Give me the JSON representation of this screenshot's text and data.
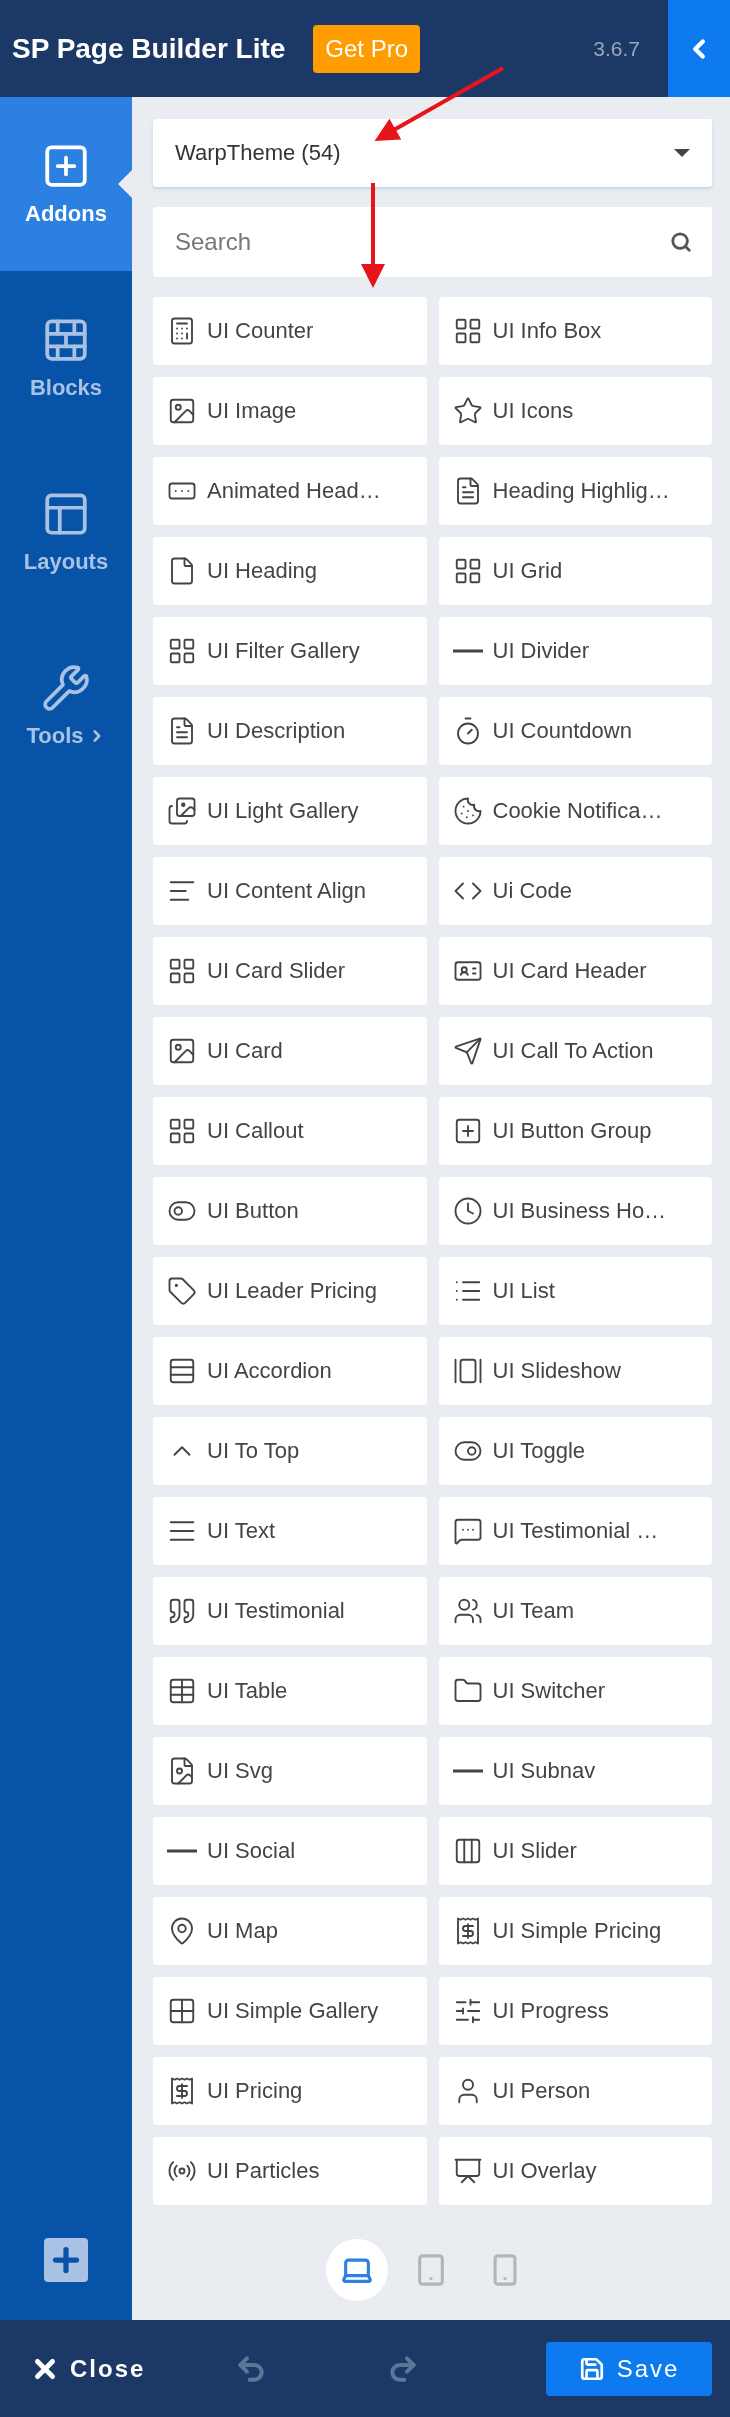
{
  "header": {
    "title": "SP Page Builder Lite",
    "badge": "Get Pro",
    "version": "3.6.7"
  },
  "sidebar": {
    "items": [
      {
        "label": "Addons",
        "selected": true,
        "submenu": false
      },
      {
        "label": "Blocks",
        "selected": false,
        "submenu": false
      },
      {
        "label": "Layouts",
        "selected": false,
        "submenu": false
      },
      {
        "label": "Tools",
        "selected": false,
        "submenu": true
      }
    ]
  },
  "category_select": {
    "value": "WarpTheme (54)"
  },
  "search": {
    "placeholder": "Search"
  },
  "addons": [
    {
      "label": "UI Counter"
    },
    {
      "label": "UI Info Box"
    },
    {
      "label": "UI Image"
    },
    {
      "label": "UI Icons"
    },
    {
      "label": "Animated Head…"
    },
    {
      "label": "Heading Highlig…"
    },
    {
      "label": "UI Heading"
    },
    {
      "label": "UI Grid"
    },
    {
      "label": "UI Filter Gallery"
    },
    {
      "label": "UI Divider"
    },
    {
      "label": "UI Description"
    },
    {
      "label": "UI Countdown"
    },
    {
      "label": "UI Light Gallery"
    },
    {
      "label": "Cookie Notifica…"
    },
    {
      "label": "UI Content Align"
    },
    {
      "label": "Ui Code"
    },
    {
      "label": "UI Card Slider"
    },
    {
      "label": "UI Card Header"
    },
    {
      "label": "UI Card"
    },
    {
      "label": "UI Call To Action"
    },
    {
      "label": "UI Callout"
    },
    {
      "label": "UI Button Group"
    },
    {
      "label": "UI Button"
    },
    {
      "label": "UI Business Ho…"
    },
    {
      "label": "UI Leader Pricing"
    },
    {
      "label": "UI List"
    },
    {
      "label": "UI Accordion"
    },
    {
      "label": "UI Slideshow"
    },
    {
      "label": "UI To Top"
    },
    {
      "label": "UI Toggle"
    },
    {
      "label": "UI Text"
    },
    {
      "label": "UI Testimonial …"
    },
    {
      "label": "UI Testimonial"
    },
    {
      "label": "UI Team"
    },
    {
      "label": "UI Table"
    },
    {
      "label": "UI Switcher"
    },
    {
      "label": "UI Svg"
    },
    {
      "label": "UI Subnav"
    },
    {
      "label": "UI Social"
    },
    {
      "label": "UI Slider"
    },
    {
      "label": "UI Map"
    },
    {
      "label": "UI Simple Pricing"
    },
    {
      "label": "UI Simple Gallery"
    },
    {
      "label": "UI Progress"
    },
    {
      "label": "UI Pricing"
    },
    {
      "label": "UI Person"
    },
    {
      "label": "UI Particles"
    },
    {
      "label": "UI Overlay"
    }
  ],
  "devices": [
    {
      "selected": true
    },
    {
      "selected": false
    },
    {
      "selected": false
    }
  ],
  "footer": {
    "close": "Close",
    "save": "Save"
  }
}
